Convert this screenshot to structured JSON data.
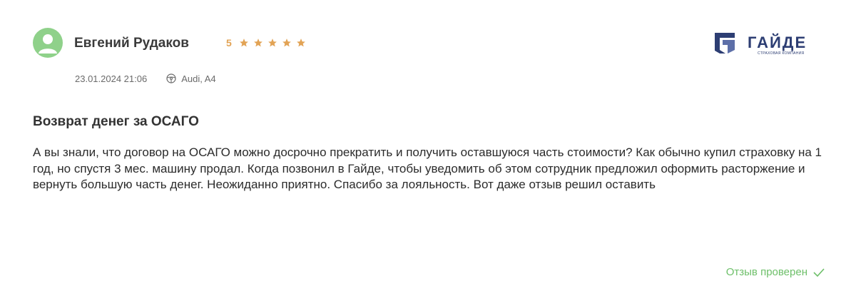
{
  "review": {
    "author": "Евгений Рудаков",
    "rating": "5",
    "stars": 5,
    "date": "23.01.2024 21:06",
    "car": "Audi, A4",
    "title": "Возврат денег за ОСАГО",
    "text": "А вы знали, что договор на ОСАГО можно досрочно прекратить и получить оставшуюся часть стоимости? Как обычно купил страховку на 1 год, но спустя 3 мес. машину продал. Когда позвонил в Гайде, чтобы уведомить об этом сотрудник предложил оформить расторжение и вернуть большую часть денег. Неожиданно приятно. Спасибо за лояльность. Вот даже отзыв решил оставить",
    "verified_label": "Отзыв проверен"
  },
  "company": {
    "logo_text": "ГАЙДЕ",
    "logo_subtitle": "СТРАХОВАЯ КОМПАНИЯ"
  },
  "icons": {
    "avatar": "user-avatar-icon",
    "star": "star-icon",
    "car": "steering-wheel-icon",
    "verified": "check-icon"
  },
  "colors": {
    "avatar_bg": "#8fd18a",
    "star": "#e2a355",
    "brand": "#2d3e73",
    "verified": "#6dbf69"
  }
}
